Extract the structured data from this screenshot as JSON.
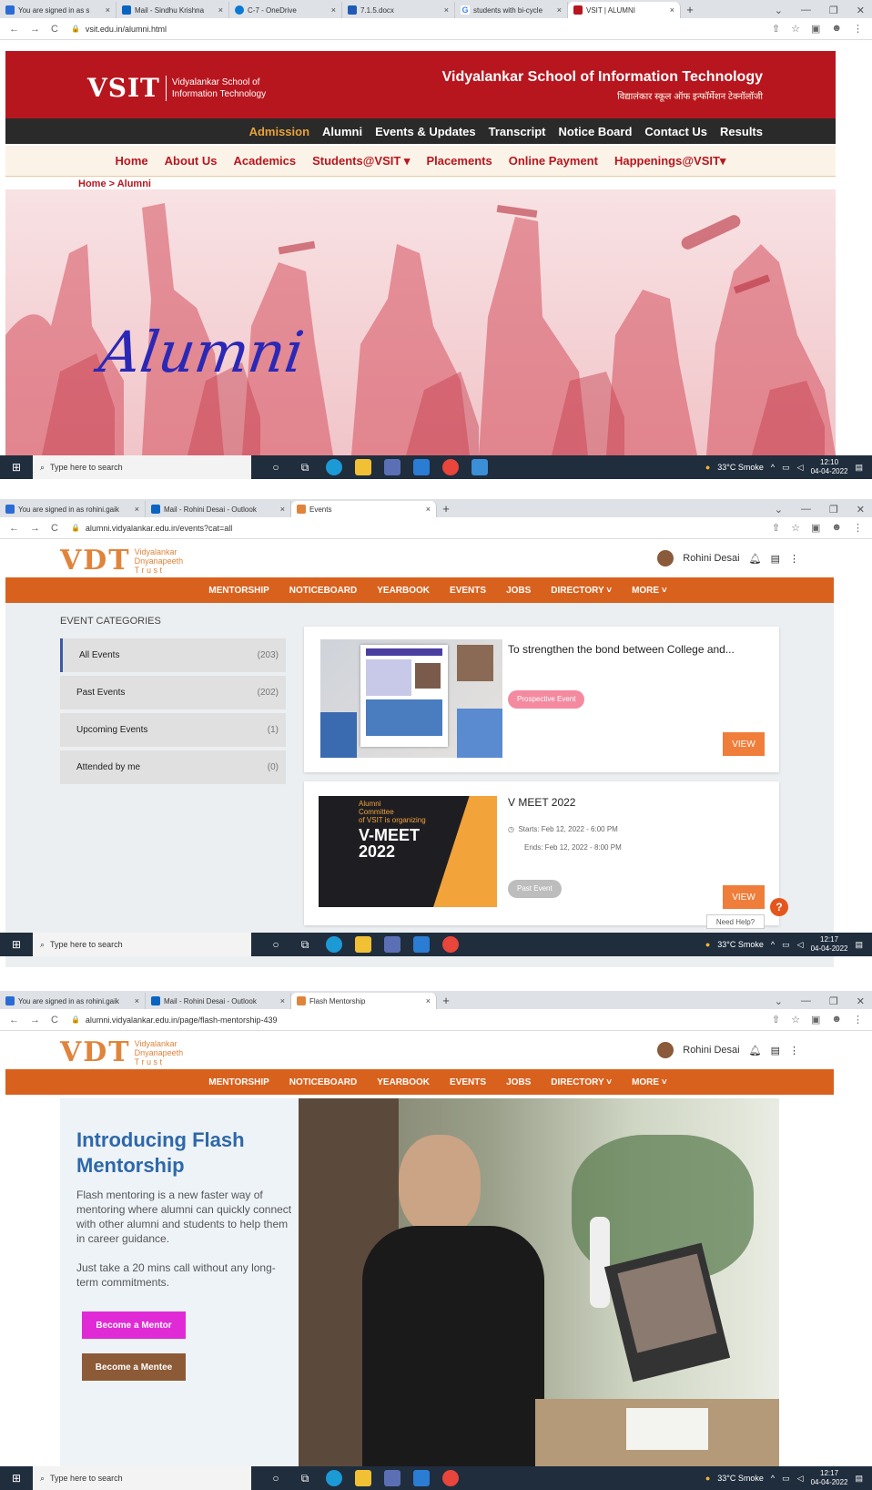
{
  "s1": {
    "tabs": [
      {
        "title": "You are signed in as s",
        "color": "#2a6bd6"
      },
      {
        "title": "Mail - Sindhu Krishna",
        "color": "#0a64c2"
      },
      {
        "title": "C-7 - OneDrive",
        "color": "#0a78d4"
      },
      {
        "title": "7.1.5.docx",
        "color": "#1f5bb5"
      },
      {
        "title": "students with bi-cycle",
        "color": "#4285f4"
      },
      {
        "title": "VSIT | ALUMNI",
        "color": "#b8161f"
      }
    ],
    "url": "vsit.edu.in/alumni.html",
    "logo_big": "VSIT",
    "logo_small_1": "Vidyalankar School of",
    "logo_small_2": "Information Technology",
    "title_en": "Vidyalankar School of Information Technology",
    "title_hi": "विद्यालंकार स्कूल ऑफ इन्फॉर्मेशन टेक्नॉलॉजी",
    "top_nav": [
      "Admission",
      "Alumni",
      "Events & Updates",
      "Transcript",
      "Notice Board",
      "Contact Us",
      "Results"
    ],
    "main_nav": [
      "Home",
      "About Us",
      "Academics",
      "Students@VSIT ▾",
      "Placements",
      "Online Payment",
      "Happenings@VSIT▾"
    ],
    "breadcrumb": "Home > Alumni",
    "hero_word": "Alumni",
    "taskbar": {
      "search": "Type here to search",
      "weather": "33°C Smoke",
      "time": "12:10",
      "date": "04-04-2022"
    }
  },
  "s2": {
    "tabs": [
      {
        "title": "You are signed in as rohini.gaik",
        "color": "#2a6bd6"
      },
      {
        "title": "Mail - Rohini Desai - Outlook",
        "color": "#0a64c2"
      },
      {
        "title": "Events",
        "color": "#e0843c"
      }
    ],
    "url": "alumni.vidyalankar.edu.in/events?cat=all",
    "logo_big": "VDT",
    "logo_small": [
      "Vidyalankar",
      "Dnyanapeeth",
      "T r u s t"
    ],
    "user": "Rohini Desai",
    "nav": [
      "MENTORSHIP",
      "NOTICEBOARD",
      "YEARBOOK",
      "EVENTS",
      "JOBS",
      "DIRECTORY ˅",
      "MORE ˅"
    ],
    "categories_title": "EVENT CATEGORIES",
    "categories": [
      {
        "label": "All Events",
        "count": "(203)"
      },
      {
        "label": "Past Events",
        "count": "(202)"
      },
      {
        "label": "Upcoming Events",
        "count": "(1)"
      },
      {
        "label": "Attended by me",
        "count": "(0)"
      }
    ],
    "event1": {
      "title": "To strengthen the bond between College and...",
      "tag": "Prospective Event",
      "view": "VIEW"
    },
    "event2": {
      "title": "V MEET 2022",
      "starts": "Starts: Feb 12, 2022 - 6:00 PM",
      "ends": "Ends: Feb 12, 2022 - 8:00 PM",
      "tag": "Past Event",
      "view": "VIEW",
      "poster_text": [
        "Alumni",
        "Committee",
        "of VSIT is organizing",
        "V-MEET",
        "2022"
      ]
    },
    "help": "Need Help?",
    "taskbar": {
      "search": "Type here to search",
      "weather": "33°C Smoke",
      "time": "12:17",
      "date": "04-04-2022"
    }
  },
  "s3": {
    "tabs": [
      {
        "title": "You are signed in as rohini.gaik",
        "color": "#2a6bd6"
      },
      {
        "title": "Mail - Rohini Desai - Outlook",
        "color": "#0a64c2"
      },
      {
        "title": "Flash Mentorship",
        "color": "#e0843c"
      }
    ],
    "url": "alumni.vidyalankar.edu.in/page/flash-mentorship-439",
    "user": "Rohini Desai",
    "title": "Introducing Flash Mentorship",
    "para1": "Flash mentoring is a new faster way of mentoring where alumni can quickly connect with other alumni and students to help them in career guidance.",
    "para2": "Just take a 20 mins call without any long-term commitments.",
    "btn_mentor": "Become a Mentor",
    "btn_mentee": "Become a Mentee",
    "taskbar": {
      "search": "Type here to search",
      "weather": "33°C Smoke",
      "time": "12:17",
      "date": "04-04-2022"
    }
  },
  "colors": {
    "vsit_red": "#b8161f",
    "vdt_orange": "#d9611e",
    "mentor_pink": "#e02ad6",
    "mentee_brown": "#8c5a36",
    "view_orange": "#ef7e3b"
  }
}
